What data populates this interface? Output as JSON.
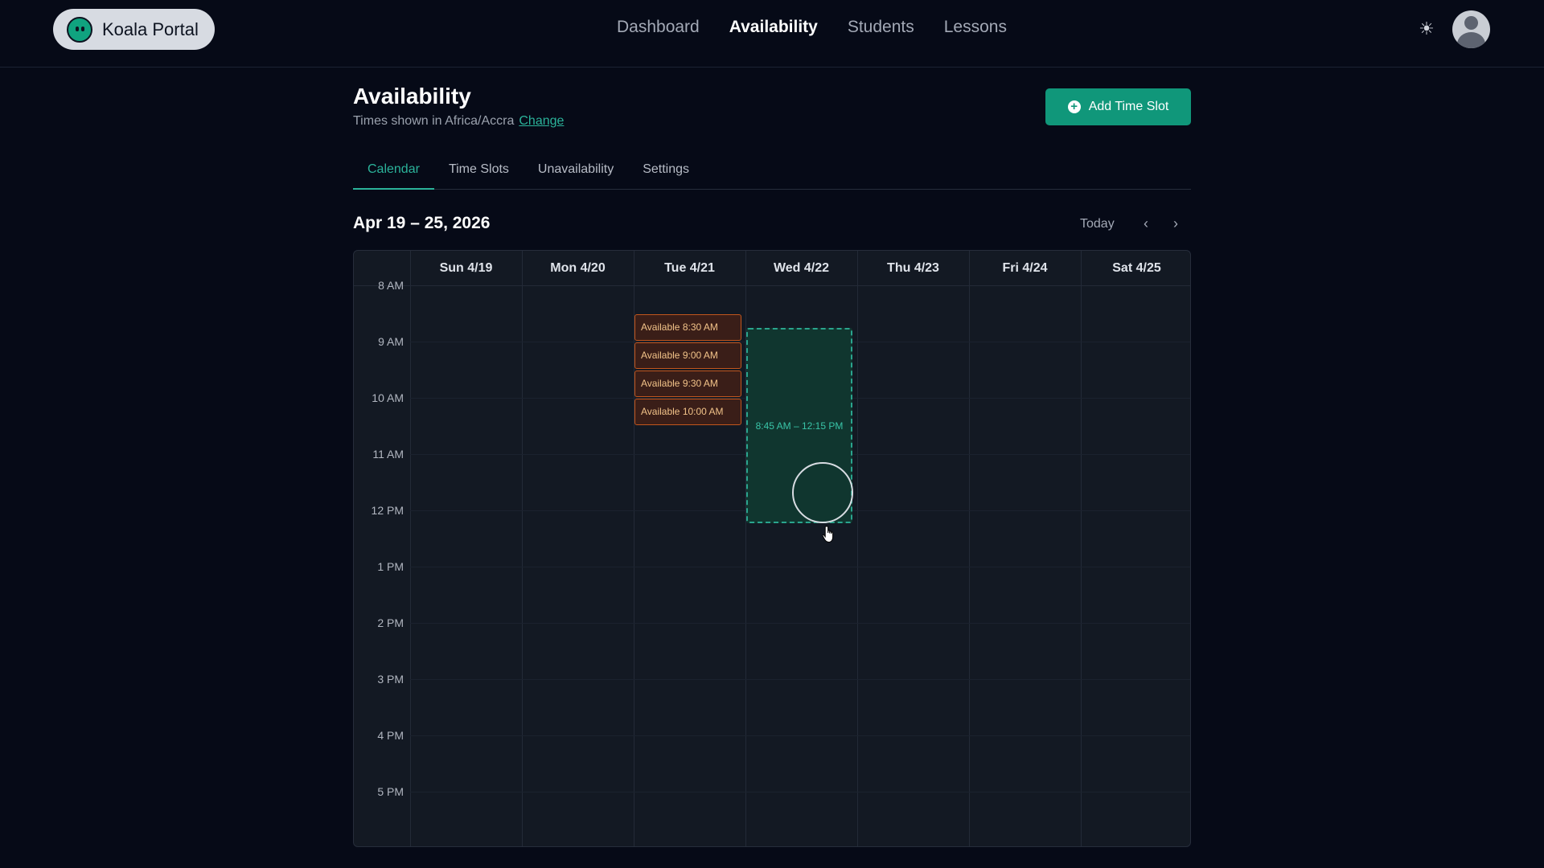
{
  "brand": {
    "name": "Koala Portal",
    "logo_icon": "koala-logo-icon"
  },
  "nav": [
    {
      "label": "Dashboard",
      "active": false
    },
    {
      "label": "Availability",
      "active": true
    },
    {
      "label": "Students",
      "active": false
    },
    {
      "label": "Lessons",
      "active": false
    }
  ],
  "header": {
    "title": "Availability",
    "timezone_text": "Times shown in Africa/Accra",
    "change_link": "Change",
    "add_button": "Add Time Slot"
  },
  "tabs": [
    {
      "label": "Calendar",
      "active": true
    },
    {
      "label": "Time Slots",
      "active": false
    },
    {
      "label": "Unavailability",
      "active": false
    },
    {
      "label": "Settings",
      "active": false
    }
  ],
  "week": {
    "range": "Apr 19 – 25, 2026",
    "today_label": "Today",
    "prev_glyph": "‹",
    "next_glyph": "›"
  },
  "calendar": {
    "days": [
      "Sun 4/19",
      "Mon 4/20",
      "Tue 4/21",
      "Wed 4/22",
      "Thu 4/23",
      "Fri 4/24",
      "Sat 4/25"
    ],
    "hours": [
      "8 AM",
      "9 AM",
      "10 AM",
      "11 AM",
      "12 PM",
      "1 PM",
      "2 PM",
      "3 PM",
      "4 PM",
      "5 PM"
    ],
    "slots": [
      {
        "day": "Tue 4/21",
        "label": "Available 8:30 AM"
      },
      {
        "day": "Tue 4/21",
        "label": "Available 9:00 AM"
      },
      {
        "day": "Tue 4/21",
        "label": "Available 9:30 AM"
      },
      {
        "day": "Tue 4/21",
        "label": "Available 10:00 AM"
      }
    ],
    "selection": {
      "day": "Wed 4/22",
      "label": "8:45 AM – 12:15 PM"
    }
  },
  "colors": {
    "accent": "#10977a",
    "slot_border": "#c2561d",
    "selection_border": "#2aa48d",
    "background": "#060a17"
  }
}
